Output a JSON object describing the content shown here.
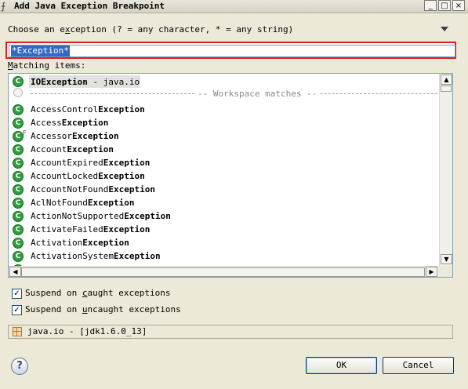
{
  "window": {
    "title": "Add Java Exception Breakpoint",
    "minimize": "_",
    "maximize": "□",
    "close": "×"
  },
  "prompt": "Choose an exception (? = any character, * = any string)",
  "filter": {
    "value": "*Exception*"
  },
  "matching_label": "Matching items:",
  "history_item": {
    "bold": "IOException",
    "rest": " - java.io"
  },
  "separator": "Workspace matches",
  "items": [
    {
      "prefix": "AccessControl",
      "bold": "Exception"
    },
    {
      "prefix": "Access",
      "bold": "Exception"
    },
    {
      "prefix": "Accessor",
      "bold": "Exception",
      "overlay": "F"
    },
    {
      "prefix": "Account",
      "bold": "Exception"
    },
    {
      "prefix": "AccountExpired",
      "bold": "Exception"
    },
    {
      "prefix": "AccountLocked",
      "bold": "Exception"
    },
    {
      "prefix": "AccountNotFound",
      "bold": "Exception"
    },
    {
      "prefix": "AclNotFound",
      "bold": "Exception"
    },
    {
      "prefix": "ActionNotSupported",
      "bold": "Exception"
    },
    {
      "prefix": "ActivateFailed",
      "bold": "Exception"
    },
    {
      "prefix": "Activation",
      "bold": "Exception"
    },
    {
      "prefix": "ActivationSystem",
      "bold": "Exception"
    }
  ],
  "options": {
    "suspend_caught": {
      "label": "Suspend on caught exceptions",
      "checked": true
    },
    "suspend_uncaught": {
      "label": "Suspend on uncaught exceptions",
      "checked": true
    }
  },
  "status": {
    "text": "java.io - [jdk1.6.0_13]"
  },
  "buttons": {
    "ok": "OK",
    "cancel": "Cancel",
    "help": "?"
  },
  "icons": {
    "class": "class-icon",
    "package": "package-icon",
    "help": "help-icon",
    "menu": "view-menu-icon"
  }
}
